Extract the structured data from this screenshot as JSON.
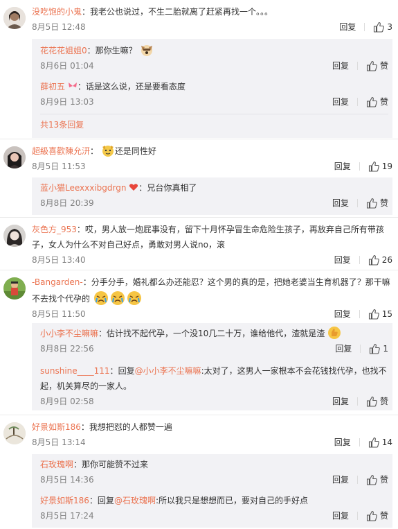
{
  "reply_label": "回复",
  "like_label": "赞",
  "colors": {
    "username": "#eb7350",
    "text": "#333333",
    "time": "#808080",
    "reply_bg": "#f2f2f5"
  },
  "comments": [
    {
      "user": "没吃饱的小鬼",
      "sep": "：",
      "text": "我老公也说过，不生二胎就离了赶紧再找一个。。。",
      "time": "8月5日 12:48",
      "likes": "3",
      "replies": [
        {
          "user": "花花花姐姐0",
          "sep": "：",
          "text": "那你生嘛？",
          "emoji": "dog-emoji",
          "time": "8月6日 01:04",
          "likes": "赞"
        },
        {
          "user": "薛初五",
          "badge": "butterfly-badge",
          "sep": "：",
          "text": "话是这么说，还是要看态度",
          "time": "8月9日 13:03",
          "likes": "赞"
        }
      ],
      "more_label": "共13条回复"
    },
    {
      "user": "超級喜歡陳允汧",
      "sep": "：",
      "text": "还是同性好",
      "emoji": "doge-emoji",
      "time": "8月5日 11:53",
      "likes": "19",
      "replies": [
        {
          "user": "蓝小猫Leexxxibgdrgn",
          "badge": "heart-badge",
          "sep": "：",
          "text": "兄台你真相了",
          "time": "8月8日 20:39",
          "likes": "赞"
        }
      ]
    },
    {
      "user": "灰色方_953",
      "sep": "：",
      "text": "哎，男人放一炮屁事没有，留下十月怀孕冒生命危险生孩子，再放弃自己所有带孩子，女人为什么不对自己好点，勇敢对男人说no，滚",
      "time": "8月5日 13:40",
      "likes": "26",
      "replies": []
    },
    {
      "user": "-Bangarden-",
      "sep": "：",
      "text": "分手分手，婚礼都么办还能忍？这个男的真的是，把她老婆当生育机器了？那干嘛不去找个代孕的",
      "time": "8月5日 11:50",
      "likes": "15",
      "replies": [
        {
          "user": "小小李不尘嘛嘛",
          "sep": "：",
          "text": "估计找不起代孕，一个没10几二十万，谁给他代，渣就是渣",
          "emoji": "thumbs-emoji",
          "time": "8月8日 22:56",
          "likes": "1"
        },
        {
          "user": "sunshine____111",
          "sep": "：",
          "pre": "回复",
          "mention": "@小小李不尘嘛嘛",
          "text": ":太对了，这男人一家根本不会花钱找代孕，也找不起，机关算尽的一家人。",
          "time": "8月9日 02:58",
          "likes": "赞"
        }
      ]
    },
    {
      "user": "好景如斯186",
      "sep": "：",
      "text": "我想把怼的人都赞一遍",
      "time": "8月5日 13:14",
      "likes": "14",
      "replies": [
        {
          "user": "石玫瑰啊",
          "sep": "：",
          "text": "那你可能赞不过来",
          "time": "8月5日 14:36",
          "likes": "赞"
        },
        {
          "user": "好景如斯186",
          "sep": "：",
          "pre": "回复",
          "mention": "@石玫瑰啊",
          "text": ":所以我只是想想而已，要对自己的手好点",
          "time": "8月5日 17:24",
          "likes": "赞"
        }
      ]
    }
  ]
}
